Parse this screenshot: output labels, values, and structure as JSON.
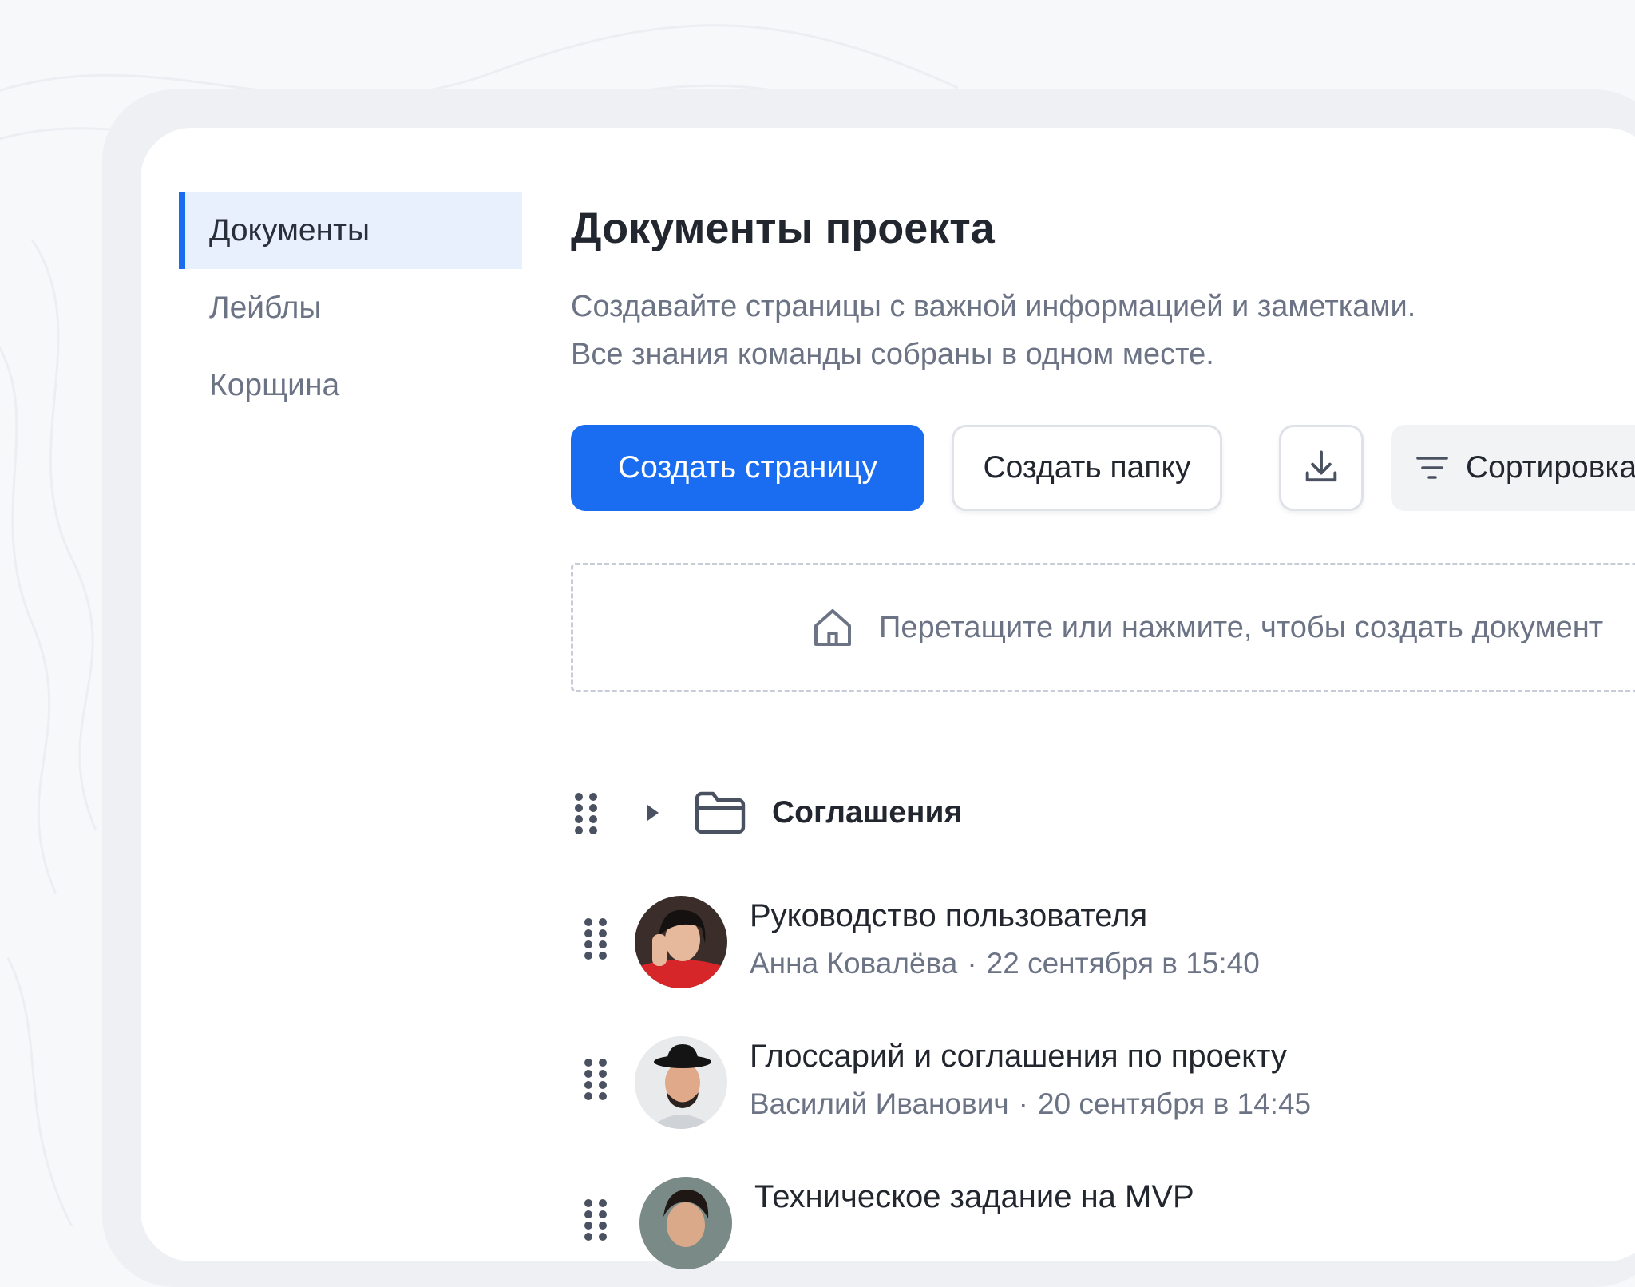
{
  "sidebar": {
    "items": [
      {
        "label": "Документы",
        "active": true
      },
      {
        "label": "Лейблы",
        "active": false
      },
      {
        "label": "Корщина",
        "active": false
      }
    ]
  },
  "main": {
    "title": "Документы проекта",
    "subtitle_line1": "Создавайте страницы с важной информацией и заметками.",
    "subtitle_line2": "Все знания команды собраны в одном месте."
  },
  "toolbar": {
    "create_page_label": "Создать страницу",
    "create_folder_label": "Создать папку",
    "download_icon": "download-icon",
    "sort_label": "Сортировка",
    "sort_icon": "filter-lines-icon"
  },
  "dropzone": {
    "icon": "home-icon",
    "label": "Перетащите или нажмите, чтобы создать документ"
  },
  "folder": {
    "name": "Соглашения",
    "icon": "folder-icon"
  },
  "documents": [
    {
      "title": "Руководство пользователя",
      "author": "Анна Ковалёва",
      "date": "22 сентября в 15:40"
    },
    {
      "title": "Глоссарий и соглашения по проекту",
      "author": "Василий Иванович",
      "date": "20 сентября в 14:45"
    },
    {
      "title": "Техническое задание на MVP",
      "author": "",
      "date": ""
    }
  ],
  "meta_separator": "·",
  "colors": {
    "accent": "#1a6cf0",
    "text_primary": "#22262e",
    "text_secondary": "#6b7385",
    "sidebar_active_bg": "#e8f0fe"
  }
}
